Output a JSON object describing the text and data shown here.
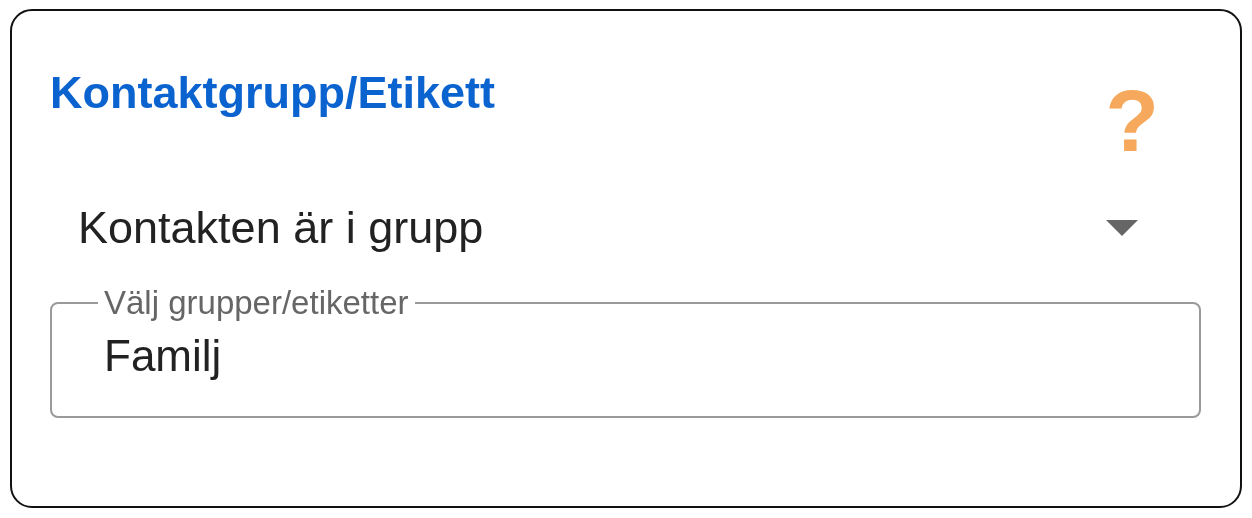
{
  "card": {
    "title": "Kontaktgrupp/Etikett",
    "help_icon": "?"
  },
  "condition_select": {
    "value": "Kontakten är i grupp"
  },
  "group_field": {
    "label": "Välj grupper/etiketter",
    "value": "Familj"
  }
}
